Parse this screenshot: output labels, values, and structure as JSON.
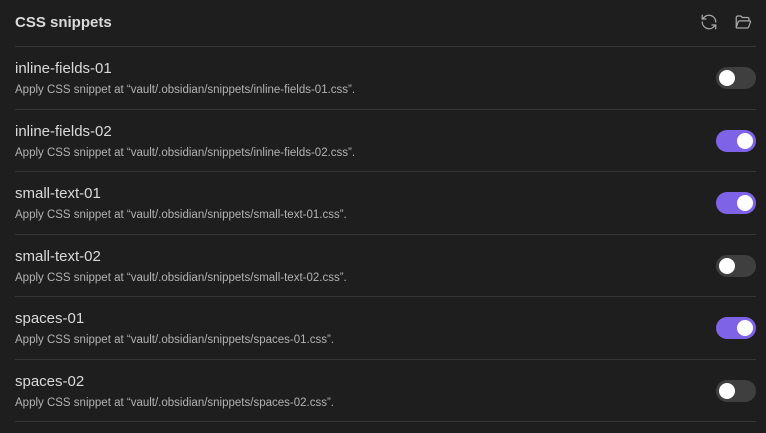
{
  "header": {
    "title": "CSS snippets",
    "reload_icon": "reload-icon",
    "folder_icon": "folder-open-icon"
  },
  "colors": {
    "accent": "#7f63e6",
    "toggle_off": "#3f3f3f",
    "background": "#1e1e1e"
  },
  "snippets": [
    {
      "name": "inline-fields-01",
      "description": "Apply CSS snippet at “vault/.obsidian/snippets/inline-fields-01.css”.",
      "enabled": false
    },
    {
      "name": "inline-fields-02",
      "description": "Apply CSS snippet at “vault/.obsidian/snippets/inline-fields-02.css”.",
      "enabled": true
    },
    {
      "name": "small-text-01",
      "description": "Apply CSS snippet at “vault/.obsidian/snippets/small-text-01.css”.",
      "enabled": true
    },
    {
      "name": "small-text-02",
      "description": "Apply CSS snippet at “vault/.obsidian/snippets/small-text-02.css”.",
      "enabled": false
    },
    {
      "name": "spaces-01",
      "description": "Apply CSS snippet at “vault/.obsidian/snippets/spaces-01.css”.",
      "enabled": true
    },
    {
      "name": "spaces-02",
      "description": "Apply CSS snippet at “vault/.obsidian/snippets/spaces-02.css”.",
      "enabled": false
    }
  ]
}
